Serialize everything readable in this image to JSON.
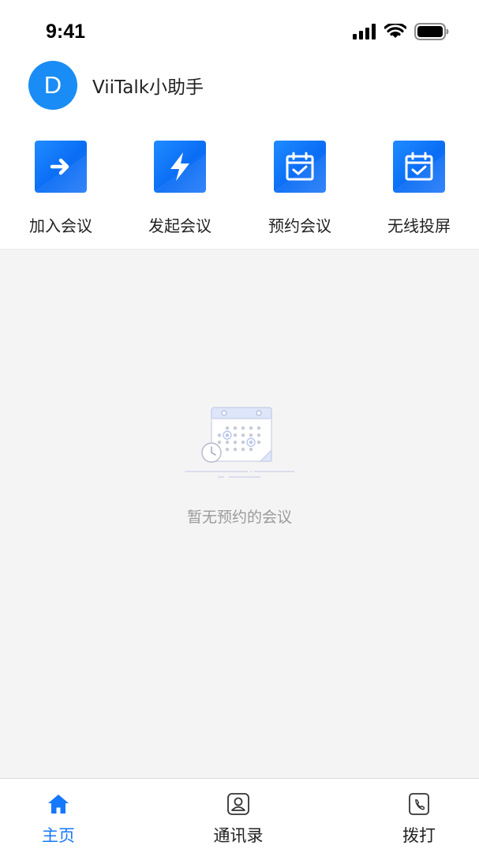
{
  "status_bar": {
    "time": "9:41"
  },
  "header": {
    "avatar_letter": "D",
    "user_name": "ViiTalk小助手"
  },
  "actions": [
    {
      "label": "加入会议",
      "icon": "arrow-right-icon"
    },
    {
      "label": "发起会议",
      "icon": "lightning-icon"
    },
    {
      "label": "预约会议",
      "icon": "calendar-check-icon"
    },
    {
      "label": "无线投屏",
      "icon": "calendar-check-icon"
    }
  ],
  "empty_state": {
    "text": "暂无预约的会议",
    "icon": "calendar-clock-illustration"
  },
  "tabs": [
    {
      "label": "主页",
      "icon": "home-icon",
      "active": true
    },
    {
      "label": "通讯录",
      "icon": "contacts-icon",
      "active": false
    },
    {
      "label": "拨打",
      "icon": "phone-icon",
      "active": false
    }
  ],
  "colors": {
    "accent": "#1677ff",
    "avatar": "#1a8cf5",
    "content_bg": "#f5f4f5",
    "empty_text": "#9a9a9a"
  }
}
